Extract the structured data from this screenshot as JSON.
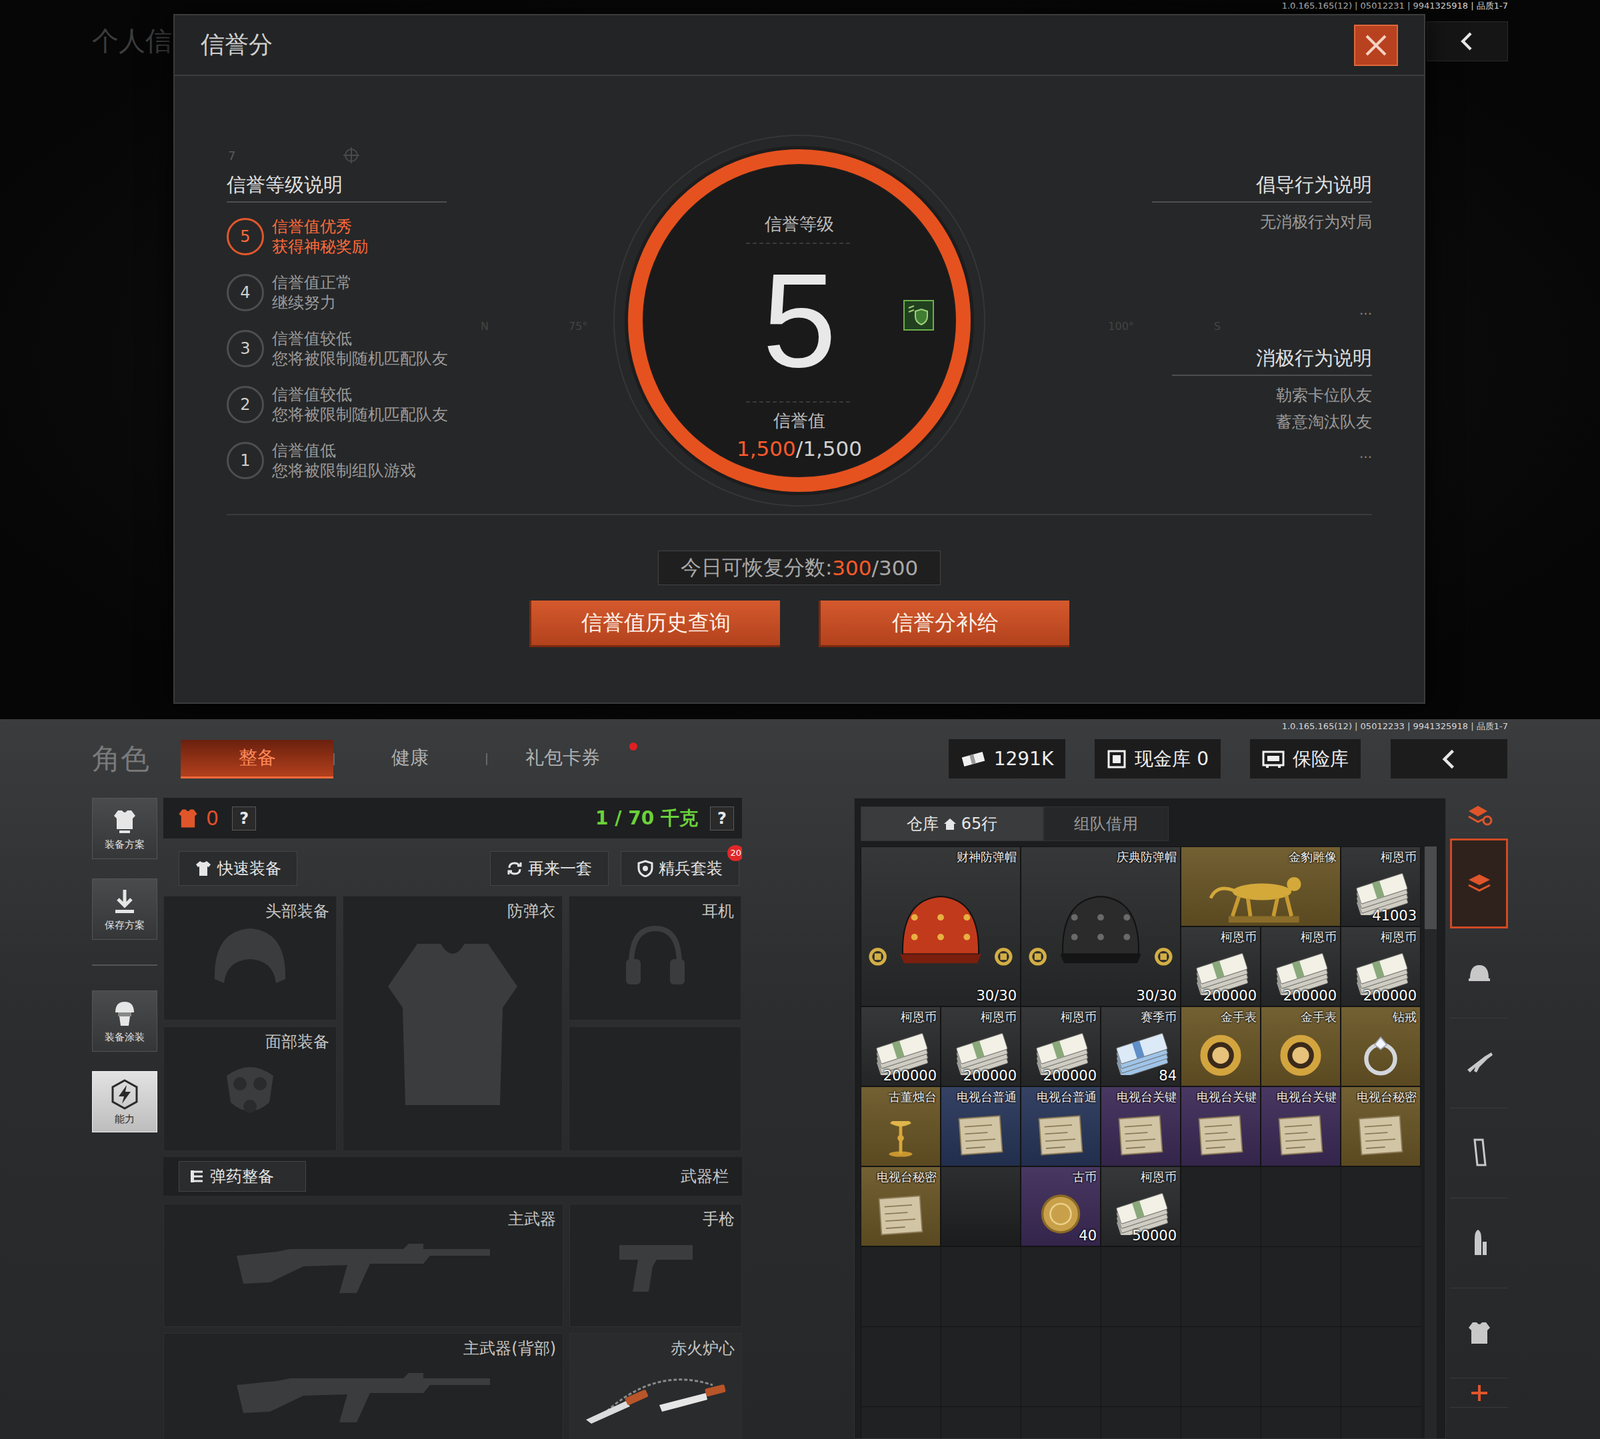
{
  "top_screen": {
    "version": "1.0.165.165(12) | 05012231 | 9941325918 | 品质1-7",
    "background_title": "个人信",
    "dialog": {
      "title": "信誉分",
      "corner_mark": "7",
      "compass": [
        "N",
        "75°",
        "100°",
        "S"
      ],
      "levels_title": "信誉等级说明",
      "levels": [
        {
          "number": "5",
          "title": "信誉值优秀",
          "desc": "获得神秘奖励",
          "selected": true
        },
        {
          "number": "4",
          "title": "信誉值正常",
          "desc": "继续努力",
          "selected": false
        },
        {
          "number": "3",
          "title": "信誉值较低",
          "desc": "您将被限制随机匹配队友",
          "selected": false
        },
        {
          "number": "2",
          "title": "信誉值较低",
          "desc": "您将被限制随机匹配队友",
          "selected": false
        },
        {
          "number": "1",
          "title": "信誉值低",
          "desc": "您将被限制组队游戏",
          "selected": false
        }
      ],
      "gauge": {
        "title": "信誉等级",
        "grade": "5",
        "score_label": "信誉值",
        "score": "1,500",
        "score_max": "/1,500",
        "level": 1
      },
      "advocated": {
        "title": "倡导行为说明",
        "items": [
          "无消极行为对局"
        ],
        "more": "..."
      },
      "negative": {
        "title": "消极行为说明",
        "items": [
          "勒索卡位队友",
          "蓄意淘汰队友"
        ],
        "more": "..."
      },
      "recovery": {
        "label": "今日可恢复分数:",
        "value": "300",
        "max": "/300"
      },
      "buttons": [
        "信誉值历史查询",
        "信誉分补给"
      ]
    }
  },
  "bottom_screen": {
    "version": "1.0.165.165(12) | 05012233 | 9941325918 | 品质1-7",
    "title": "角色",
    "tabs": [
      {
        "label": "整备",
        "selected": true,
        "dot": false
      },
      {
        "label": "健康",
        "selected": false,
        "dot": false
      },
      {
        "label": "礼包卡券",
        "selected": false,
        "dot": true
      }
    ],
    "wallet": [
      {
        "kind": "money",
        "label": "1291K"
      },
      {
        "kind": "cash",
        "label": "现金库 0"
      },
      {
        "kind": "safe",
        "label": "保险库"
      }
    ],
    "sidebar": [
      {
        "label": "装备方案",
        "kind": "plan",
        "group": 1,
        "selected": false
      },
      {
        "label": "保存方案",
        "kind": "save",
        "group": 1,
        "selected": false
      },
      {
        "label": "装备涂装",
        "kind": "skin",
        "group": 2,
        "selected": false
      },
      {
        "label": "能力",
        "kind": "ability",
        "group": 2,
        "selected": true
      }
    ],
    "loadout": {
      "armor_count": "0",
      "help": "?",
      "weight": "1 / 70 千克",
      "actions": [
        {
          "label": "快速装备",
          "kind": "quick",
          "badge": ""
        },
        {
          "label": "再来一套",
          "kind": "repeat",
          "badge": ""
        },
        {
          "label": "精兵套装",
          "kind": "elite",
          "badge": "20"
        }
      ],
      "slots": [
        {
          "label": "头部装备",
          "kind": "head"
        },
        {
          "label": "防弹衣",
          "kind": "vest"
        },
        {
          "label": "耳机",
          "kind": "headset"
        },
        {
          "label": "面部装备",
          "kind": "face"
        }
      ],
      "ammo_button": "弹药整备",
      "weapons_label": "武器栏",
      "weapons": [
        {
          "label": "主武器",
          "kind": "rifle",
          "equipped": false
        },
        {
          "label": "手枪",
          "kind": "pistol",
          "equipped": false
        },
        {
          "label": "主武器(背部)",
          "kind": "rifle",
          "equipped": false
        },
        {
          "label": "赤火炉心",
          "kind": "knife",
          "equipped": true
        }
      ]
    },
    "warehouse": {
      "tabs": [
        {
          "label": "仓库",
          "suffix": "65行",
          "selected": true
        },
        {
          "label": "组队借用",
          "suffix": "",
          "selected": false
        }
      ],
      "scroll": {
        "level": 0.14
      },
      "items": [
        {
          "name": "财神防弹帽",
          "kind": "redhelmet",
          "w": 2,
          "h": 2,
          "count": "30/30",
          "color": "#2a2b2c"
        },
        {
          "name": "庆典防弹帽",
          "kind": "blackhelmet",
          "w": 2,
          "h": 2,
          "count": "30/30",
          "color": "#2a2b2c"
        },
        {
          "name": "金豹雕像",
          "kind": "statue",
          "w": 2,
          "h": 1,
          "count": "",
          "color": "#6a5626"
        },
        {
          "name": "柯恩币",
          "kind": "cash",
          "w": 1,
          "h": 1,
          "count": "41003",
          "color": "#2a2b2c"
        },
        {
          "name": "柯恩币",
          "kind": "cash",
          "w": 1,
          "h": 1,
          "count": "200000",
          "color": "#2a2b2c"
        },
        {
          "name": "柯恩币",
          "kind": "cash",
          "w": 1,
          "h": 1,
          "count": "200000",
          "color": "#2a2b2c"
        },
        {
          "name": "柯恩币",
          "kind": "cash",
          "w": 1,
          "h": 1,
          "count": "200000",
          "color": "#2a2b2c"
        },
        {
          "name": "柯恩币",
          "kind": "cash",
          "w": 1,
          "h": 1,
          "count": "200000",
          "color": "#2a2b2c"
        },
        {
          "name": "柯恩币",
          "kind": "cash",
          "w": 1,
          "h": 1,
          "count": "200000",
          "color": "#2a2b2c"
        },
        {
          "name": "柯恩币",
          "kind": "cash",
          "w": 1,
          "h": 1,
          "count": "200000",
          "color": "#2a2b2c"
        },
        {
          "name": "赛季币",
          "kind": "ticket",
          "w": 1,
          "h": 1,
          "count": "84",
          "color": "#2a2b2c"
        },
        {
          "name": "金手表",
          "kind": "watch",
          "w": 1,
          "h": 1,
          "count": "",
          "color": "#6a5626"
        },
        {
          "name": "金手表",
          "kind": "watch",
          "w": 1,
          "h": 1,
          "count": "",
          "color": "#6a5626"
        },
        {
          "name": "钻戒",
          "kind": "ring",
          "w": 1,
          "h": 1,
          "count": "",
          "color": "#6a5626"
        },
        {
          "name": "古董烛台",
          "kind": "candle",
          "w": 1,
          "h": 1,
          "count": "",
          "color": "#6a5626"
        },
        {
          "name": "电视台普通",
          "kind": "map",
          "w": 1,
          "h": 1,
          "count": "",
          "color": "#28365a"
        },
        {
          "name": "电视台普通",
          "kind": "map",
          "w": 1,
          "h": 1,
          "count": "",
          "color": "#28365a"
        },
        {
          "name": "电视台关键",
          "kind": "map",
          "w": 1,
          "h": 1,
          "count": "",
          "color": "#3d2b58"
        },
        {
          "name": "电视台关键",
          "kind": "map",
          "w": 1,
          "h": 1,
          "count": "",
          "color": "#3d2b58"
        },
        {
          "name": "电视台关键",
          "kind": "map",
          "w": 1,
          "h": 1,
          "count": "",
          "color": "#3d2b58"
        },
        {
          "name": "电视台秘密",
          "kind": "map",
          "w": 1,
          "h": 1,
          "count": "",
          "color": "#6a5626"
        },
        {
          "name": "电视台秘密",
          "kind": "map",
          "w": 1,
          "h": 1,
          "count": "",
          "color": "#6a5626"
        },
        {
          "name": "",
          "kind": "empty",
          "w": 1,
          "h": 1,
          "count": "",
          "color": "#202122"
        },
        {
          "name": "古币",
          "kind": "coin",
          "w": 1,
          "h": 1,
          "count": "40",
          "color": "#3d2b58"
        },
        {
          "name": "柯恩币",
          "kind": "cash",
          "w": 1,
          "h": 1,
          "count": "50000",
          "color": "#2a2b2c"
        }
      ]
    },
    "categories": [
      {
        "kind": "sort",
        "selected": false
      },
      {
        "kind": "all",
        "selected": true
      },
      {
        "kind": "helmet",
        "selected": false
      },
      {
        "kind": "rifle",
        "selected": false
      },
      {
        "kind": "magazine",
        "selected": false
      },
      {
        "kind": "bullet",
        "selected": false
      },
      {
        "kind": "vest",
        "selected": false
      },
      {
        "kind": "add",
        "selected": false
      }
    ]
  }
}
